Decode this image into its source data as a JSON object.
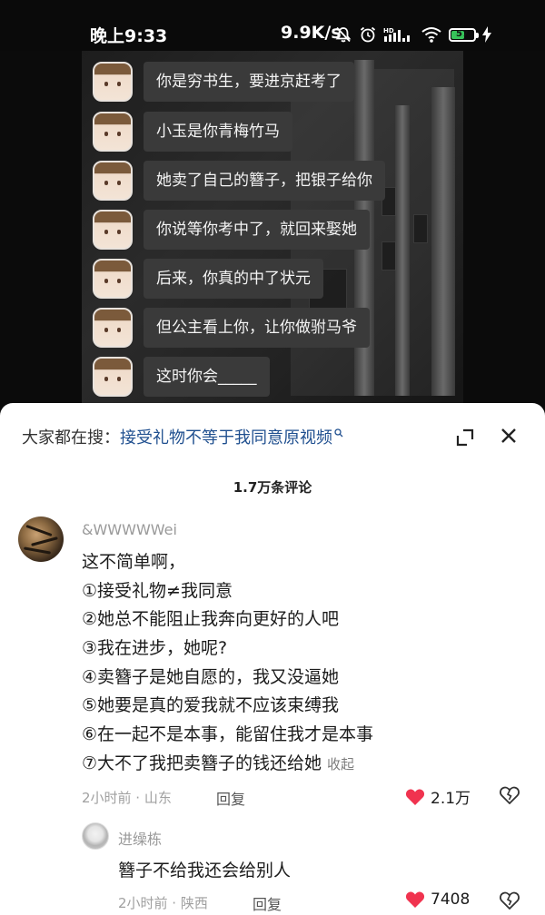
{
  "status_bar": {
    "time": "晚上9:33",
    "net_speed": "9.9K/s",
    "battery_level": "57",
    "icons": [
      "mute-icon",
      "alarm-icon",
      "hd-icon",
      "signal-icon",
      "wifi-icon",
      "battery-icon",
      "charging-icon"
    ]
  },
  "video": {
    "chat": [
      "你是穷书生，要进京赶考了",
      "小玉是你青梅竹马",
      "她卖了自己的簪子，把银子给你",
      "你说等你考中了，就回来娶她",
      "后来，你真的中了状元",
      "但公主看上你，让你做驸马爷",
      "这时你会_____"
    ]
  },
  "panel": {
    "search_prefix": "大家都在搜：",
    "search_link": "接受礼物不等于我同意原视频",
    "comment_count": "1.7万条评论"
  },
  "comment": {
    "author": "&WWWWWei",
    "lines": [
      "这不简单啊，",
      "①接受礼物≠我同意",
      "②她总不能阻止我奔向更好的人吧",
      "③我在进步，她呢?",
      "④卖簪子是她自愿的，我又没逼她",
      "⑤她要是真的爱我就不应该束缚我",
      "⑥在一起不是本事，能留住我才是本事",
      "⑦大不了我把卖簪子的钱还给她"
    ],
    "collapse_label": "收起",
    "meta": "2小时前 · 山东",
    "reply_label": "回复",
    "likes": "2.1万"
  },
  "reply": {
    "author": "进缲栋",
    "text": "簪子不给我还会给别人",
    "meta": "2小时前 · 陕西",
    "reply_label": "回复",
    "likes": "7408"
  },
  "colors": {
    "like_red": "#f0334f",
    "search_link": "#1f4f8f",
    "battery_green": "#37c45a"
  }
}
